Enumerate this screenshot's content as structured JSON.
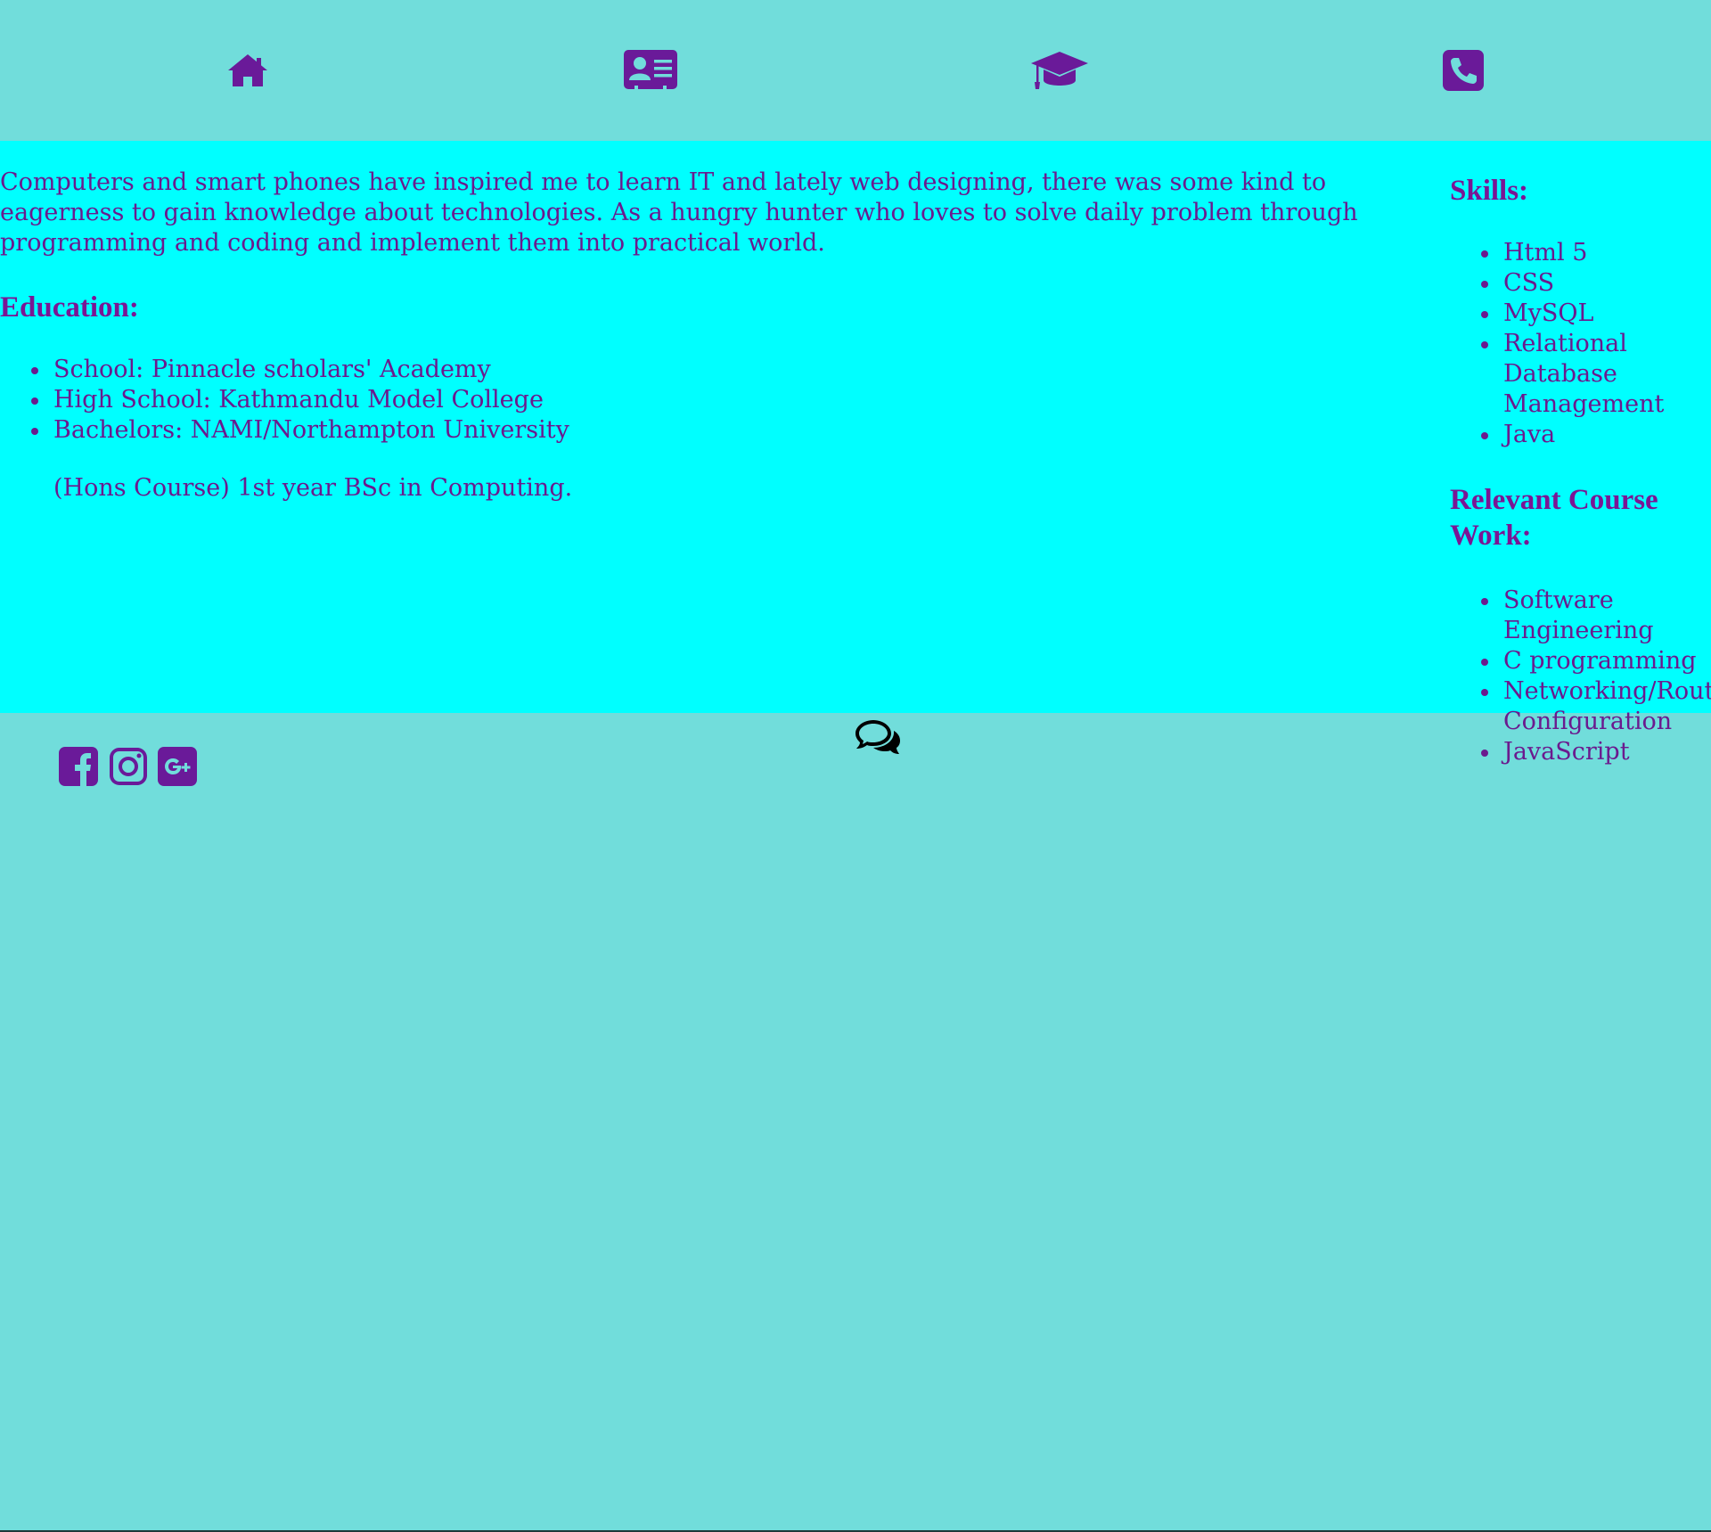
{
  "nav": {
    "items": [
      {
        "icon": "home-icon"
      },
      {
        "icon": "id-card-icon"
      },
      {
        "icon": "graduation-cap-icon"
      },
      {
        "icon": "phone-icon"
      }
    ]
  },
  "about": {
    "text": "Computers and smart phones have inspired me to learn IT and lately web designing, there was some kind to eagerness to gain knowledge about technologies. As a hungry hunter who loves to solve daily problem through programming and coding and implement them into practical world."
  },
  "education": {
    "heading": "Education:",
    "items": [
      "School: Pinnacle scholars' Academy",
      "High School: Kathmandu Model College",
      "Bachelors: NAMI/Northampton University"
    ],
    "note": "(Hons Course) 1st year BSc in Computing."
  },
  "skills": {
    "heading": "Skills:",
    "items": [
      "Html 5",
      "CSS",
      "MySQL",
      "Relational Database Management",
      "Java"
    ]
  },
  "coursework": {
    "heading": "Relevant Course Work:",
    "items": [
      "Software Engineering",
      "C programming",
      "Networking/Router Configuration",
      "JavaScript"
    ]
  },
  "footer": {
    "social": [
      "facebook-icon",
      "instagram-icon",
      "google-plus-icon"
    ],
    "chat_icon": "chat-icon"
  },
  "colors": {
    "accent": "#6b1a8e",
    "nav_bg": "#71dddb",
    "main_bg": "#00ffff"
  }
}
